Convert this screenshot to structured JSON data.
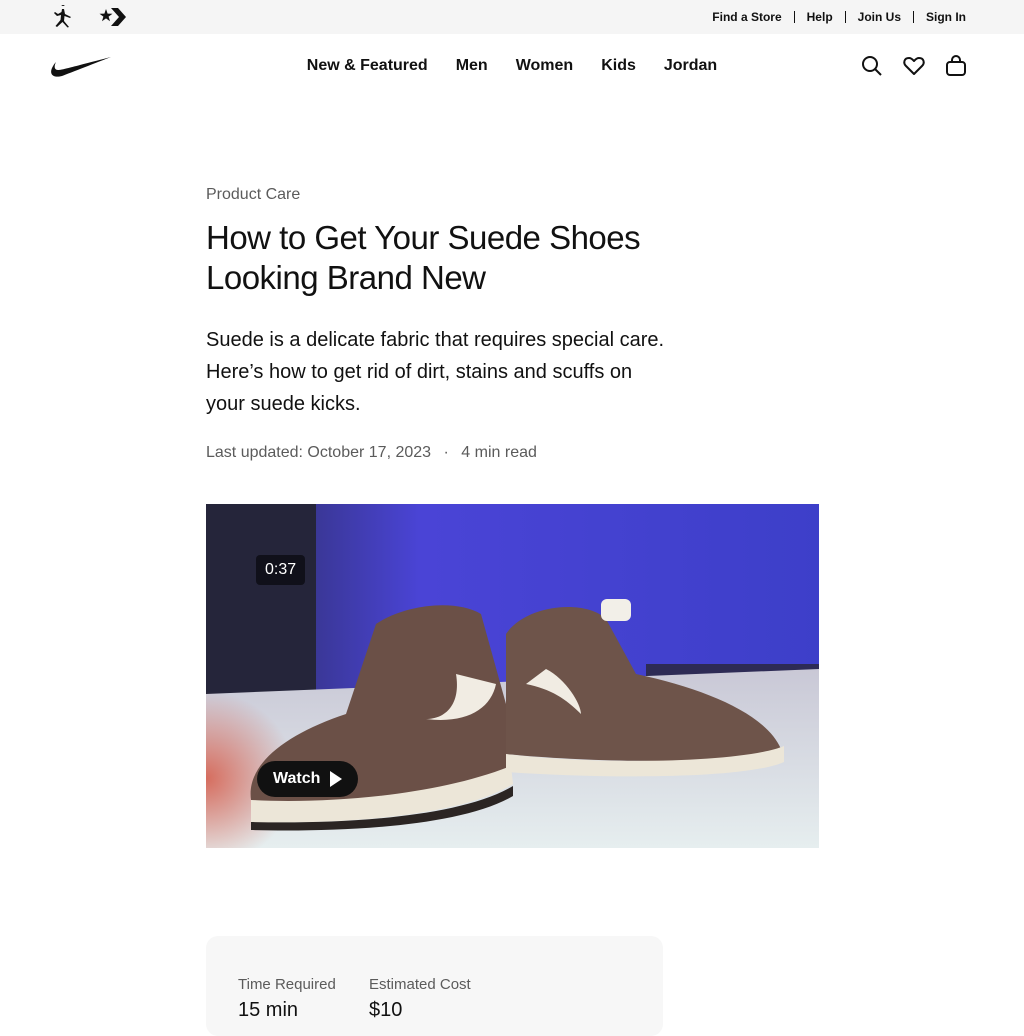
{
  "utility_bar": {
    "brands": [
      "jordan-jumpman",
      "converse-star-chevron"
    ],
    "links": [
      "Find a Store",
      "Help",
      "Join Us",
      "Sign In"
    ]
  },
  "nav": {
    "logo": "nike-swoosh",
    "items": [
      "New & Featured",
      "Men",
      "Women",
      "Kids",
      "Jordan"
    ],
    "actions": [
      "search-icon",
      "heart-icon",
      "bag-icon"
    ]
  },
  "article": {
    "category": "Product Care",
    "title": "How to Get Your Suede Shoes Looking Brand New",
    "intro": "Suede is a delicate fabric that requires special care. Here’s how to get rid of dirt, stains and scuffs on your suede kicks.",
    "updated": "Last updated: October 17, 2023",
    "separator": "·",
    "read_time": "4 min read"
  },
  "video": {
    "duration": "0:37",
    "watch_label": "Watch"
  },
  "info": {
    "time_label": "Time Required",
    "time_value": "15 min",
    "cost_label": "Estimated Cost",
    "cost_value": "$10"
  }
}
